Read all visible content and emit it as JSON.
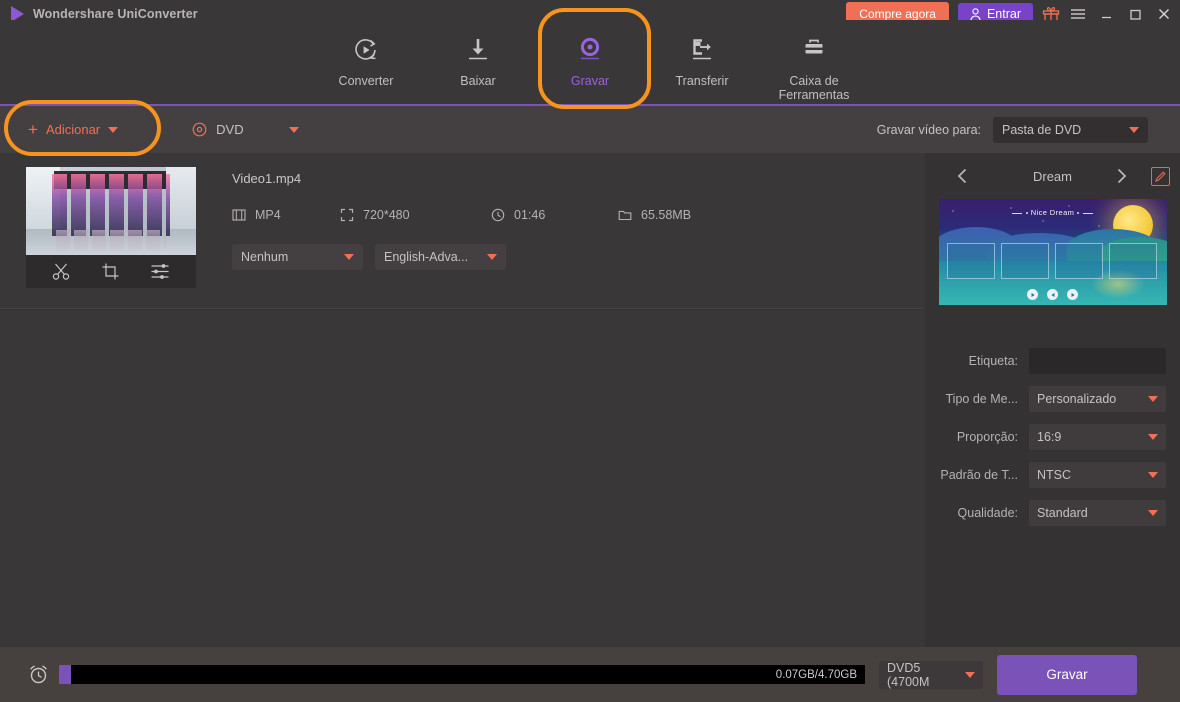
{
  "app": {
    "title": "Wondershare UniConverter",
    "logo_icon": "play-triangle-icon"
  },
  "titlebar": {
    "buy_label": "Compre agora",
    "login_label": "Entrar",
    "login_icon": "person-icon",
    "gift_icon": "gift-icon",
    "menu_icon": "hamburger-menu-icon",
    "minimize_icon": "minimize-icon",
    "maximize_icon": "maximize-icon",
    "close_icon": "close-icon"
  },
  "nav": {
    "tabs": [
      {
        "label": "Converter",
        "icon": "convert-refresh-play-icon",
        "active": false
      },
      {
        "label": "Baixar",
        "icon": "download-arrow-icon",
        "active": false
      },
      {
        "label": "Gravar",
        "icon": "burn-disc-icon",
        "active": true
      },
      {
        "label": "Transferir",
        "icon": "transfer-export-icon",
        "active": false
      },
      {
        "label": "Caixa de\nFerramentas",
        "label_line1": "Caixa de",
        "label_line2": "Ferramentas",
        "icon": "toolbox-icon",
        "active": false
      }
    ]
  },
  "toolbar": {
    "add_label": "Adicionar",
    "add_icon": "plus-icon",
    "dvd_label": "DVD",
    "dvd_icon": "disc-icon",
    "output_label": "Gravar vídeo para:",
    "output_value": "Pasta de DVD"
  },
  "video": {
    "name": "Video1.mp4",
    "format_label": "MP4",
    "format_icon": "film-strip-icon",
    "resolution_label": "720*480",
    "resolution_icon": "resize-icon",
    "duration_label": "01:46",
    "duration_icon": "clock-icon",
    "size_label": "65.58MB",
    "size_icon": "folder-icon",
    "subtitle_value": "Nenhum",
    "audio_value": "English-Adva...",
    "tools": [
      {
        "name": "trim-icon"
      },
      {
        "name": "crop-icon"
      },
      {
        "name": "effect-icon"
      }
    ]
  },
  "right_panel": {
    "template_name": "Dream",
    "prev_icon": "chevron-left-icon",
    "next_icon": "chevron-right-icon",
    "edit_icon": "pencil-edit-icon",
    "preview": {
      "title": "Nice Dream",
      "cells": 4,
      "buttons": [
        "play-button-icon",
        "prev-button-icon",
        "next-button-icon"
      ]
    },
    "fields": [
      {
        "label": "Etiqueta:",
        "type": "input",
        "value": "",
        "name": "label-field"
      },
      {
        "label": "Tipo de Me...",
        "type": "select",
        "value": "Personalizado",
        "name": "media-type-select"
      },
      {
        "label": "Proporção:",
        "type": "select",
        "value": "16:9",
        "name": "aspect-ratio-select"
      },
      {
        "label": "Padrão de T...",
        "type": "select",
        "value": "NTSC",
        "name": "tv-standard-select"
      },
      {
        "label": "Qualidade:",
        "type": "select",
        "value": "Standard",
        "name": "quality-select"
      }
    ]
  },
  "bottom": {
    "timer_icon": "alarm-clock-icon",
    "usage_label": "0.07GB/4.70GB",
    "progress_percent": 1.5,
    "disc_type": "DVD5 (4700M",
    "burn_label": "Gravar"
  },
  "colors": {
    "accent_purple": "#7a52b8",
    "accent_orange": "#f07055",
    "annotation": "#f7941d",
    "background": "#3a3738",
    "toolbar_bg": "#443f40",
    "panel_bg": "#353233",
    "bottom_bg": "#46413f"
  }
}
